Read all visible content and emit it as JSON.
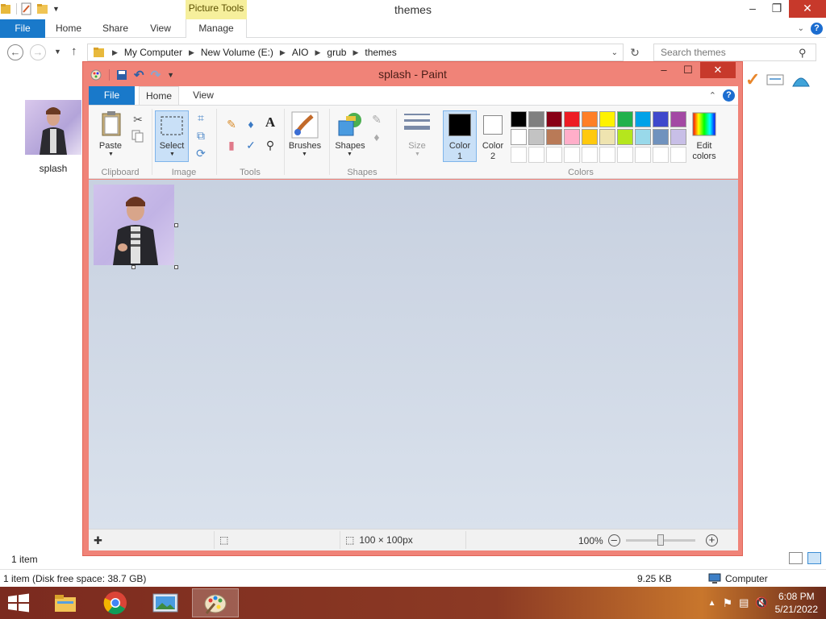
{
  "explorer": {
    "title": "themes",
    "context_tab": "Picture Tools",
    "tabs": [
      "File",
      "Home",
      "Share",
      "View",
      "Manage"
    ],
    "window_controls": {
      "minimize": "–",
      "restore": "❐",
      "close": "✕"
    },
    "breadcrumb": [
      "My Computer",
      "New Volume (E:)",
      "AIO",
      "grub",
      "themes"
    ],
    "search_placeholder": "Search themes",
    "file": {
      "name": "splash"
    },
    "item_count": "1 item",
    "status": {
      "details": "1 item (Disk free space: 38.7 GB)",
      "size": "9.25 KB",
      "location": "Computer"
    }
  },
  "paint": {
    "title": "splash - Paint",
    "tabs": [
      "File",
      "Home",
      "View"
    ],
    "ribbon": {
      "groups": [
        "Clipboard",
        "Image",
        "Tools",
        "Shapes",
        "Colors"
      ],
      "paste": "Paste",
      "select": "Select",
      "brushes": "Brushes",
      "shapes": "Shapes",
      "size": "Size",
      "color1": [
        "Color",
        "1"
      ],
      "color2": [
        "Color",
        "2"
      ],
      "edit_colors": [
        "Edit",
        "colors"
      ]
    },
    "colors": {
      "color1": "#000000",
      "color2": "#ffffff",
      "palette_row1": [
        "#000000",
        "#7f7f7f",
        "#880015",
        "#ed1c24",
        "#ff7f27",
        "#fff200",
        "#22b14c",
        "#00a2e8",
        "#3f48cc",
        "#a349a4"
      ],
      "palette_row2": [
        "#ffffff",
        "#c3c3c3",
        "#b97a57",
        "#ffaec9",
        "#ffc90e",
        "#efe4b0",
        "#b5e61d",
        "#99d9ea",
        "#7092be",
        "#c8bfe7"
      ],
      "empty_slots": 10
    },
    "status": {
      "image_size": "100 × 100px",
      "zoom": "100%",
      "zoom_level": 0.5
    }
  },
  "taskbar": {
    "apps": [
      "file-explorer",
      "chrome",
      "photo-viewer",
      "paint"
    ],
    "active_app": "paint",
    "time": "6:08 PM",
    "date": "5/21/2022"
  }
}
